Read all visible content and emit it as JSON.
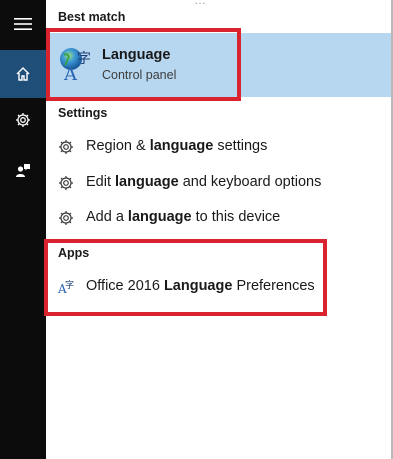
{
  "top_clipped_text": "…",
  "sections": {
    "best_match": "Best match",
    "settings": "Settings",
    "apps": "Apps"
  },
  "best_match": {
    "title": "Language",
    "subtitle": "Control panel",
    "icon": "language-globe-icon"
  },
  "settings_items": [
    {
      "pre": "Region & ",
      "bold": "language",
      "post": " settings",
      "icon": "gear-icon"
    },
    {
      "pre": "Edit ",
      "bold": "language",
      "post": " and keyboard options",
      "icon": "gear-icon"
    },
    {
      "pre": "Add a ",
      "bold": "language",
      "post": " to this device",
      "icon": "gear-icon"
    }
  ],
  "apps_items": [
    {
      "pre": "Office 2016 ",
      "bold": "Language",
      "post": " Preferences",
      "icon": "office-language-icon"
    }
  ],
  "sidebar": {
    "items": [
      "menu-icon",
      "home-icon",
      "settings-icon",
      "feedback-icon"
    ]
  },
  "colors": {
    "highlight": "#b7d7f1",
    "annotation_red": "#d9232e",
    "sidebar_bg": "#0c0c0c",
    "sidebar_active": "#1f4e79"
  }
}
